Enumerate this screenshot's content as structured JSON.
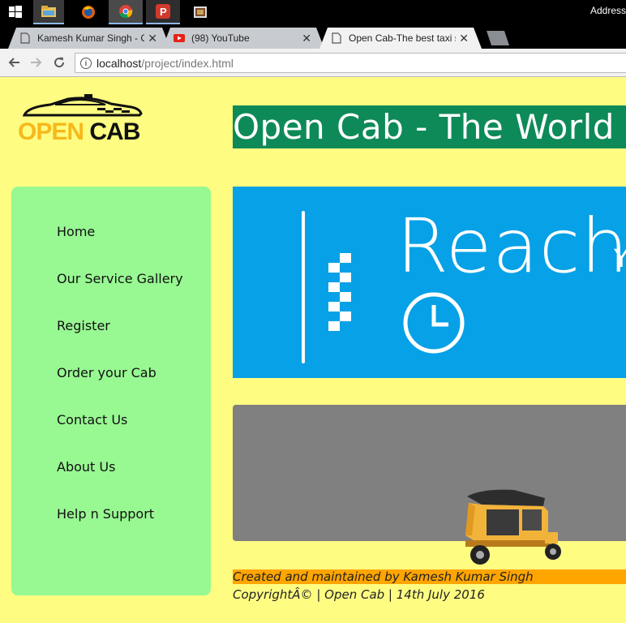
{
  "taskbar": {
    "address_label": "Address",
    "apps": [
      "start-icon",
      "file-explorer-icon",
      "firefox-icon",
      "chrome-icon",
      "proxy-app-icon",
      "app-icon"
    ]
  },
  "browser": {
    "tabs": [
      {
        "title": "Kamesh Kumar Singh - C",
        "icon": "document-icon",
        "active": false
      },
      {
        "title": "(98) YouTube",
        "icon": "youtube-icon",
        "active": false
      },
      {
        "title": "Open Cab-The best taxi s",
        "icon": "document-icon",
        "active": true
      }
    ],
    "url_host": "localhost",
    "url_path": "/project/index.html"
  },
  "site": {
    "logo_open": "OPEN",
    "logo_cab": "CAB",
    "title": "Open Cab - The World",
    "nav": [
      "Home",
      "Our Service Gallery",
      "Register",
      "Order your Cab",
      "Contact Us",
      "About Us",
      "Help n Support"
    ],
    "hero_text": "Reach",
    "hero_text_partial": "Y",
    "footer_created": "Created and maintained by Kamesh Kumar Singh",
    "footer_copyright": "CopyrightÂ© | Open Cab | 14th July 2016"
  },
  "colors": {
    "page_bg": "#fefd82",
    "sidebar_bg": "#98f892",
    "title_bg": "#0e8a58",
    "hero_bg": "#06a1e6",
    "gray_panel": "#808080",
    "footer_highlight": "#ffa500",
    "logo_yellow": "#f7b81b"
  }
}
